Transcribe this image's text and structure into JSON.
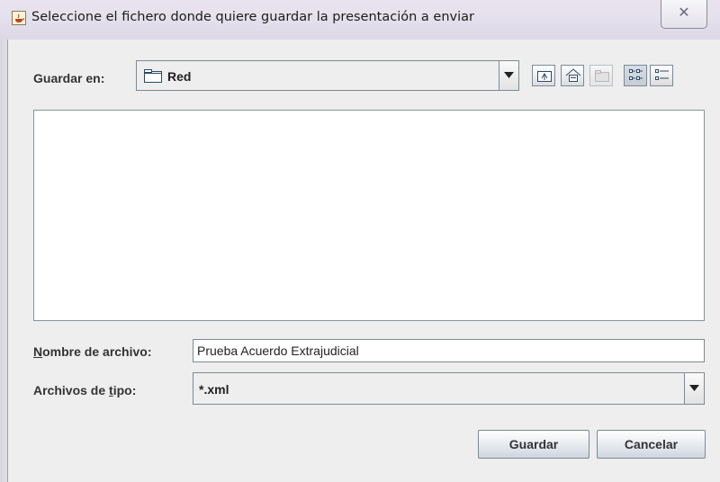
{
  "window": {
    "title": "Seleccione el fichero donde quiere guardar la presentación a enviar",
    "app_icon": "java-cup-icon",
    "close_icon": "close-icon"
  },
  "save_in": {
    "label_mnemonic": "Guardar en:",
    "selected": "Red",
    "icon": "folder-icon"
  },
  "toolbar": {
    "buttons": [
      {
        "name": "up-one-level-button",
        "icon": "up-folder-icon",
        "enabled": true
      },
      {
        "name": "home-button",
        "icon": "home-icon",
        "enabled": true
      },
      {
        "name": "new-folder-button",
        "icon": "new-folder-icon",
        "enabled": false
      },
      {
        "name": "list-view-button",
        "icon": "list-view-icon",
        "enabled": true,
        "pressed": true
      },
      {
        "name": "details-view-button",
        "icon": "details-view-icon",
        "enabled": true
      }
    ]
  },
  "file_list": {
    "items": []
  },
  "file_name": {
    "label_first": "N",
    "label_rest": "ombre de archivo:",
    "value": "Prueba Acuerdo Extrajudicial"
  },
  "file_type": {
    "label_before": "Archivos de ",
    "label_underlined": "t",
    "label_after": "ipo:",
    "selected": "*.xml"
  },
  "actions": {
    "save_label": "Guardar",
    "cancel_label": "Cancelar"
  },
  "colors": {
    "window_bg": "#eeeeee",
    "titlebar": "#e6e1ee",
    "border": "#7a8a99"
  }
}
